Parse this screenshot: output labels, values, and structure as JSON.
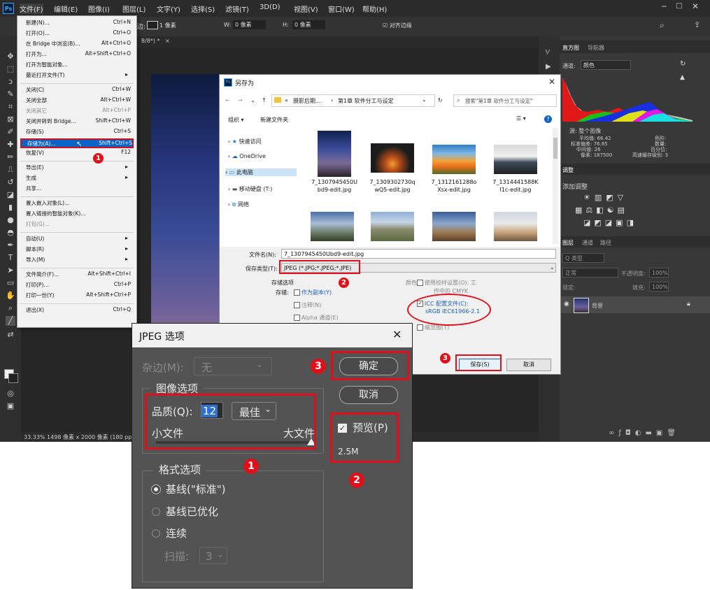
{
  "menubar": {
    "logo": "Ps",
    "items": [
      "文件(F)",
      "编辑(E)",
      "图像(I)",
      "图层(L)",
      "文字(Y)",
      "选择(S)",
      "滤镜(T)",
      "3D(D)",
      "视图(V)",
      "窗口(W)",
      "帮助(H)"
    ]
  },
  "optbar": {
    "stroke_label": "边:",
    "stroke_size": "1 像素",
    "w_label": "W:",
    "w_value": "0 像素",
    "h_label": "H:",
    "h_value": "0 像素",
    "align_edges": "对齐边缘"
  },
  "document": {
    "tab": "8/8*) *",
    "status": "33.33%  1498 像素 x 2000 像素 (180 ppi)"
  },
  "file_menu": {
    "items": [
      {
        "label": "新建(N)...",
        "shortcut": "Ctrl+N"
      },
      {
        "label": "打开(O)...",
        "shortcut": "Ctrl+O"
      },
      {
        "label": "在 Bridge 中浏览(B)...",
        "shortcut": "Alt+Ctrl+O"
      },
      {
        "label": "打开为...",
        "shortcut": "Alt+Shift+Ctrl+O"
      },
      {
        "label": "打开为智能对象...",
        "shortcut": ""
      },
      {
        "label": "最近打开文件(T)",
        "shortcut": ""
      },
      {
        "label": "关闭(C)",
        "shortcut": "Ctrl+W"
      },
      {
        "label": "关闭全部",
        "shortcut": "Alt+Ctrl+W"
      },
      {
        "label": "关闭其它",
        "shortcut": "Alt+Ctrl+P"
      },
      {
        "label": "关闭并转到 Bridge...",
        "shortcut": "Shift+Ctrl+W"
      },
      {
        "label": "存储(S)",
        "shortcut": "Ctrl+S"
      },
      {
        "label": "存储为(A)...",
        "shortcut": "Shift+Ctrl+S"
      },
      {
        "label": "恢复(V)",
        "shortcut": "F12"
      },
      {
        "label": "导出(E)",
        "shortcut": ""
      },
      {
        "label": "生成",
        "shortcut": ""
      },
      {
        "label": "共享...",
        "shortcut": ""
      },
      {
        "label": "置入嵌入对象(L)...",
        "shortcut": ""
      },
      {
        "label": "置入链接的智能对象(K)...",
        "shortcut": ""
      },
      {
        "label": "打包(G)...",
        "shortcut": ""
      },
      {
        "label": "自动(U)",
        "shortcut": ""
      },
      {
        "label": "脚本(R)",
        "shortcut": ""
      },
      {
        "label": "导入(M)",
        "shortcut": ""
      },
      {
        "label": "文件简介(F)...",
        "shortcut": "Alt+Shift+Ctrl+I"
      },
      {
        "label": "打印(P)...",
        "shortcut": "Ctrl+P"
      },
      {
        "label": "打印一份(Y)",
        "shortcut": "Alt+Shift+Ctrl+P"
      },
      {
        "label": "退出(X)",
        "shortcut": "Ctrl+Q"
      }
    ],
    "badge": "1"
  },
  "save_as": {
    "title": "另存为",
    "breadcrumb": [
      "«",
      "摄影后期...",
      "第1章 软件分工与设定"
    ],
    "search_placeholder": "搜索\"第1章 软件分工与设定\"",
    "organize": "组织 ▾",
    "new_folder": "新建文件夹",
    "tree": [
      "快速访问",
      "OneDrive",
      "此电脑",
      "移动硬盘 (T:)",
      "网络"
    ],
    "files": [
      "7_1307945450Ubd9-edit.jpg",
      "7_1309302730qwQ5-edit.jpg",
      "7_1312161288oXsx-edit.jpg",
      "7_1314441588Kl1c-edit.jpg"
    ],
    "files_display": [
      [
        "7_1307945450U",
        "bd9-edit.jpg"
      ],
      [
        "7_1309302730q",
        "wQ5-edit.jpg"
      ],
      [
        "7_1312161288o",
        "Xsx-edit.jpg"
      ],
      [
        "7_1314441588K",
        "l1c-edit.jpg"
      ]
    ],
    "filename_label": "文件名(N):",
    "filename_value": "7_1307945450Ubd9-edit.jpg",
    "filetype_label": "保存类型(T):",
    "filetype_value": "JPEG (*.JPG;*.JPEG;*.JPE)",
    "save_options_label": "存储选项",
    "save_label": "存储:",
    "as_copy": "作为副本(Y)",
    "notes": "注释(N)",
    "alpha": "Alpha 通道(E)",
    "color_label": "颜色:",
    "proof_setup": "使用校样设置(O): 工",
    "proof_sub": "作中的 CMYK",
    "icc_label": "ICC 配置文件(C):",
    "icc_value": "sRGB IEC61966-2.1",
    "thumbnail": "缩览图(T)",
    "save_button": "保存(S)",
    "cancel_button": "取消",
    "badge_type": "2",
    "badge_save": "3"
  },
  "jpeg_options": {
    "title": "JPEG 选项",
    "matte_label": "杂边(M):",
    "matte_value": "无",
    "image_options": "图像选项",
    "quality_label": "品质(Q):",
    "quality_value": "12",
    "quality_preset": "最佳",
    "small_file": "小文件",
    "large_file": "大文件",
    "quality_level": 1.0,
    "format_options": "格式选项",
    "baseline_std": "基线(\"标准\")",
    "baseline_opt": "基线已优化",
    "progressive": "连续",
    "scans_label": "扫描:",
    "scans_value": "3",
    "ok_button": "确定",
    "cancel_button": "取消",
    "preview_label": "预览(P)",
    "file_size": "2.5M",
    "badge_quality": "1",
    "badge_preview": "2",
    "badge_ok": "3"
  },
  "histogram_panel": {
    "tabs": [
      "直方图",
      "导航器"
    ],
    "channel_label": "通道:",
    "channel_value": "颜色",
    "source": "源:  整个图像",
    "stats_left": [
      "平均值: 66.42",
      "标准偏差: 76.85",
      "中间值: 26",
      "像素: 187500"
    ],
    "stats_right": [
      "色阶:",
      "数量:",
      "百分位:",
      "高速缓存级别: 3"
    ]
  },
  "adjust_panel": {
    "title": "调整",
    "add": "添加调整"
  },
  "layers_panel": {
    "tabs": [
      "图层",
      "通道",
      "路径"
    ],
    "kind": "Q 类型",
    "blend": "正常",
    "opacity_label": "不透明度:",
    "opacity_value": "100%",
    "lock_label": "锁定:",
    "fill_label": "填充:",
    "fill_value": "100%",
    "layer_name": "背景"
  },
  "colors": {
    "accent": "#0a64c8",
    "annotation_red": "#e0101a",
    "ps_dark": "#3a3a3a"
  }
}
